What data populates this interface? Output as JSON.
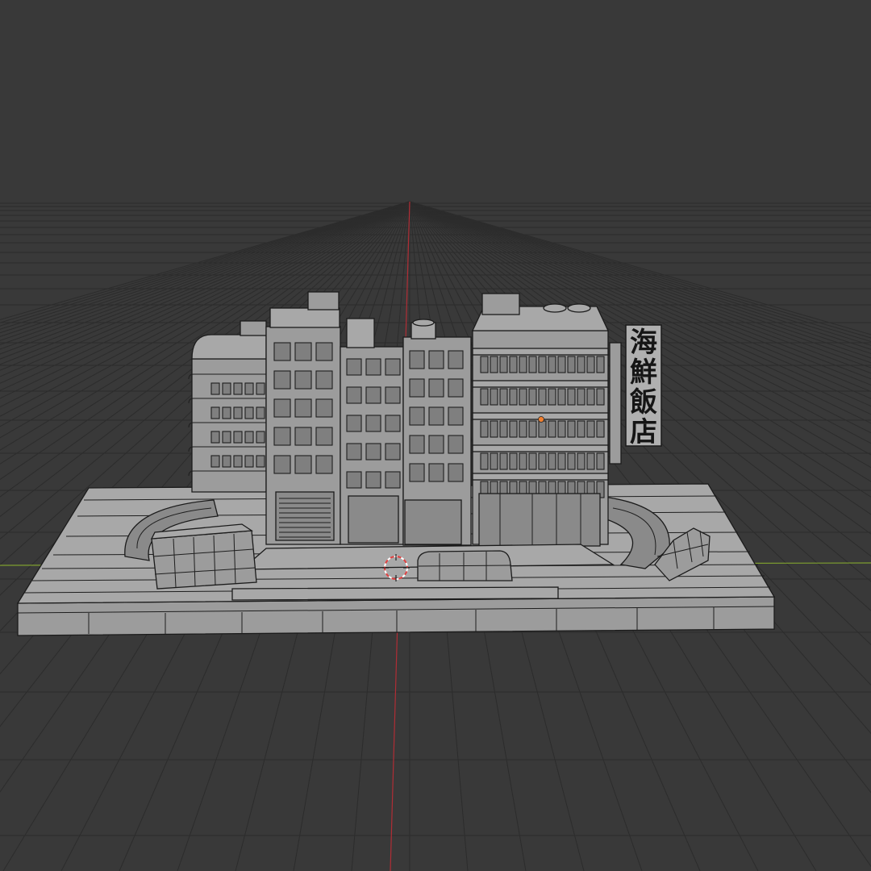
{
  "viewport": {
    "background": "#393939",
    "grid_color": "#2c2c2c",
    "axis_x_color": "#8fb33a",
    "axis_y_color": "#c8323c",
    "wire_color": "#1b1b1b",
    "mesh_fill": "#9c9c9c"
  },
  "scene": {
    "sign": {
      "characters": [
        "海",
        "鮮",
        "飯",
        "店"
      ]
    },
    "origin_marker_color": "#f08030",
    "cursor_icon": "3d-cursor-icon"
  }
}
